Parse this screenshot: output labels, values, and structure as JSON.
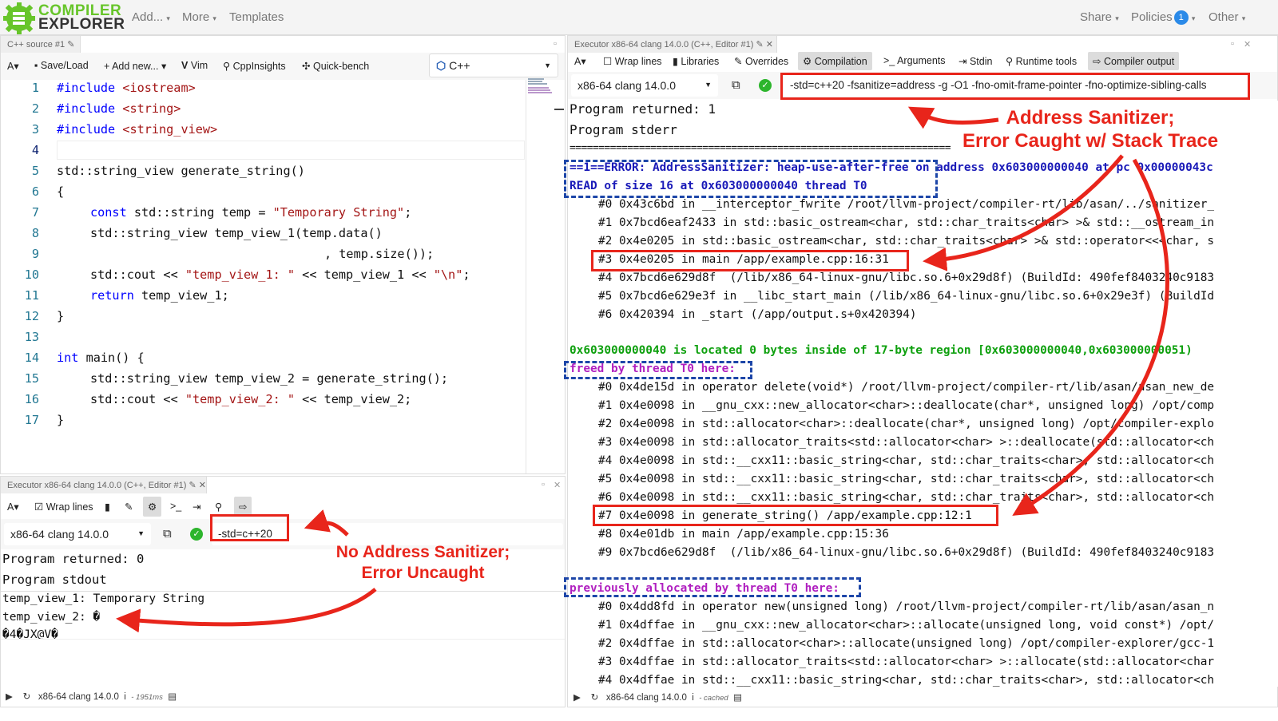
{
  "nav": {
    "logo_line1": "COMPILER",
    "logo_line2": "EXPLORER",
    "add": "Add...",
    "more": "More",
    "templates": "Templates",
    "share": "Share",
    "policies": "Policies",
    "policies_badge": "1",
    "other": "Other"
  },
  "editor": {
    "tab": "C++ source #1",
    "toolbar": {
      "font": "A",
      "save": "Save/Load",
      "add_new": "+ Add new...",
      "vim": "Vim",
      "cppinsights": "CppInsights",
      "quickbench": "Quick-bench",
      "language": "C++"
    },
    "line_numbers": [
      "1",
      "2",
      "3",
      "4",
      "5",
      "6",
      "7",
      "8",
      "9",
      "10",
      "11",
      "12",
      "13",
      "14",
      "15",
      "16",
      "17"
    ],
    "code": {
      "l1a": "#include ",
      "l1b": "<iostream>",
      "l2a": "#include ",
      "l2b": "<string>",
      "l3a": "#include ",
      "l3b": "<string_view>",
      "l5": "std::string_view generate_string()",
      "l6": "{",
      "l7a": "const ",
      "l7b": "std::string temp = ",
      "l7c": "\"Temporary String\"",
      "l7d": ";",
      "l8": "std::string_view temp_view_1(temp.data()",
      "l9": ", temp.size());",
      "l10a": "std::cout << ",
      "l10b": "\"temp_view_1: \"",
      "l10c": " << temp_view_1 << ",
      "l10d": "\"\\n\"",
      "l10e": ";",
      "l11a": "return ",
      "l11b": "temp_view_1;",
      "l12": "}",
      "l14a": "int ",
      "l14b": "main() {",
      "l15": "std::string_view temp_view_2 = generate_string();",
      "l16a": "std::cout << ",
      "l16b": "\"temp_view_2: \"",
      "l16c": " << temp_view_2;",
      "l17": "}"
    }
  },
  "exec_right": {
    "tab": "Executor x86-64 clang 14.0.0 (C++, Editor #1)",
    "toolbar": {
      "font": "A",
      "wrap": "Wrap lines",
      "libraries": "Libraries",
      "overrides": "Overrides",
      "compilation": "Compilation",
      "arguments": "Arguments",
      "stdin": "Stdin",
      "runtime": "Runtime tools",
      "compiler_output": "Compiler output"
    },
    "compiler": "x86-64 clang 14.0.0",
    "flags": "-std=c++20 -fsanitize=address -g -O1 -fno-omit-frame-pointer -fno-optimize-sibling-calls",
    "returned": "Program returned: 1",
    "stderr": "Program stderr",
    "separator": "==================================================================",
    "error_line": "==1==ERROR: AddressSanitizer: heap-use-after-free on address 0x603000000040 at pc 0x00000043c",
    "read_line": "READ of size 16 at 0x603000000040 thread T0",
    "read_stack": [
      "#0 0x43c6bd in __interceptor_fwrite /root/llvm-project/compiler-rt/lib/asan/../sanitizer_",
      "#1 0x7bcd6eaf2433 in std::basic_ostream<char, std::char_traits<char> >& std::__ostream_in",
      "#2 0x4e0205 in std::basic_ostream<char, std::char_traits<char> >& std::operator<<<char, s",
      "#3 0x4e0205 in main /app/example.cpp:16:31",
      "#4 0x7bcd6e629d8f  (/lib/x86_64-linux-gnu/libc.so.6+0x29d8f) (BuildId: 490fef8403240c9183",
      "#5 0x7bcd6e629e3f in __libc_start_main (/lib/x86_64-linux-gnu/libc.so.6+0x29e3f) (BuildId",
      "#6 0x420394 in _start (/app/output.s+0x420394)"
    ],
    "located": "0x603000000040 is located 0 bytes inside of 17-byte region [0x603000000040,0x603000000051)",
    "freed": "freed by thread T0 here:",
    "freed_stack": [
      "#0 0x4de15d in operator delete(void*) /root/llvm-project/compiler-rt/lib/asan/asan_new_de",
      "#1 0x4e0098 in __gnu_cxx::new_allocator<char>::deallocate(char*, unsigned long) /opt/comp",
      "#2 0x4e0098 in std::allocator<char>::deallocate(char*, unsigned long) /opt/compiler-explo",
      "#3 0x4e0098 in std::allocator_traits<std::allocator<char> >::deallocate(std::allocator<ch",
      "#4 0x4e0098 in std::__cxx11::basic_string<char, std::char_traits<char>, std::allocator<ch",
      "#5 0x4e0098 in std::__cxx11::basic_string<char, std::char_traits<char>, std::allocator<ch",
      "#6 0x4e0098 in std::__cxx11::basic_string<char, std::char_traits<char>, std::allocator<ch",
      "#7 0x4e0098 in generate_string() /app/example.cpp:12:1",
      "#8 0x4e01db in main /app/example.cpp:15:36",
      "#9 0x7bcd6e629d8f  (/lib/x86_64-linux-gnu/libc.so.6+0x29d8f) (BuildId: 490fef8403240c9183"
    ],
    "alloc": "previously allocated by thread T0 here:",
    "alloc_stack": [
      "#0 0x4dd8fd in operator new(unsigned long) /root/llvm-project/compiler-rt/lib/asan/asan_n",
      "#1 0x4dffae in __gnu_cxx::new_allocator<char>::allocate(unsigned long, void const*) /opt/",
      "#2 0x4dffae in std::allocator<char>::allocate(unsigned long) /opt/compiler-explorer/gcc-1",
      "#3 0x4dffae in std::allocator_traits<std::allocator<char> >::allocate(std::allocator<char",
      "#4 0x4dffae in std::__cxx11::basic_string<char, std::char_traits<char>, std::allocator<ch"
    ],
    "status_compiler": "x86-64 clang 14.0.0",
    "status_info": "i",
    "status_time": "- cached"
  },
  "exec_left": {
    "tab": "Executor x86-64 clang 14.0.0 (C++, Editor #1)",
    "toolbar": {
      "font": "A",
      "wrap": "Wrap lines"
    },
    "compiler": "x86-64 clang 14.0.0",
    "flags": "-std=c++20",
    "returned": "Program returned: 0",
    "stdout": "Program stdout",
    "out1": "temp_view_1: Temporary String",
    "out2": "temp_view_2: �",
    "out3": "�4�JX@V�",
    "status_compiler": "x86-64 clang 14.0.0",
    "status_info": "i",
    "status_time": "- 1951ms"
  },
  "annotations": {
    "asan_title": "Address Sanitizer;\nError Caught w/ Stack Trace",
    "noasan_title": "No Address Sanitizer;\nError Uncaught"
  },
  "colors": {
    "accent_red": "#e8251b",
    "asan_blue": "#1a1ab8",
    "asan_green": "#0ea00e",
    "asan_purple": "#b020c0",
    "logo_green": "#67c52a"
  }
}
